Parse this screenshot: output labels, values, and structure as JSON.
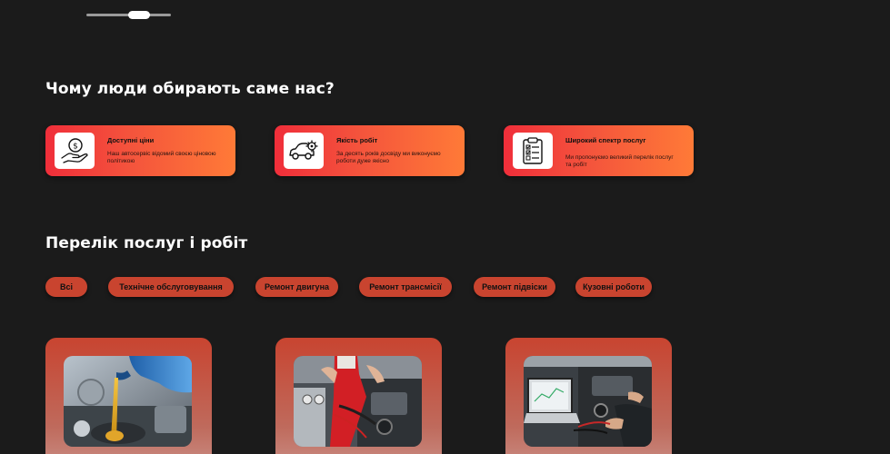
{
  "why_section": {
    "title": "Чому люди обирають саме нас?",
    "features": [
      {
        "icon": "price-hand-icon",
        "title": "Доступні ціни",
        "description": "Наш автосервіс відомий своєю ціновою політикою"
      },
      {
        "icon": "car-gear-icon",
        "title": "Якість робіт",
        "description": "За десять років досвіду ми виконуємо роботи дуже якісно"
      },
      {
        "icon": "clipboard-checklist-icon",
        "title": "Широкий спектр послуг",
        "description": "Ми пропонуємо великий перелік послуг та робіт"
      }
    ]
  },
  "services_section": {
    "title": "Перелік послуг і робіт",
    "filters": [
      "Всі",
      "Технічне обслуговування",
      "Ремонт двигуна",
      "Ремонт трансмісії",
      "Ремонт підвіски",
      "Кузовні роботи"
    ],
    "cards": [
      {
        "image": "oil-pouring-photo"
      },
      {
        "image": "mechanic-engine-photo"
      },
      {
        "image": "car-diagnostics-photo"
      }
    ]
  },
  "slider": {
    "active_index": 1,
    "total": 2
  },
  "colors": {
    "background": "#1b1b1b",
    "accent_start": "#f02e3a",
    "accent_end": "#ff7a37",
    "pill": "#c9442f"
  }
}
